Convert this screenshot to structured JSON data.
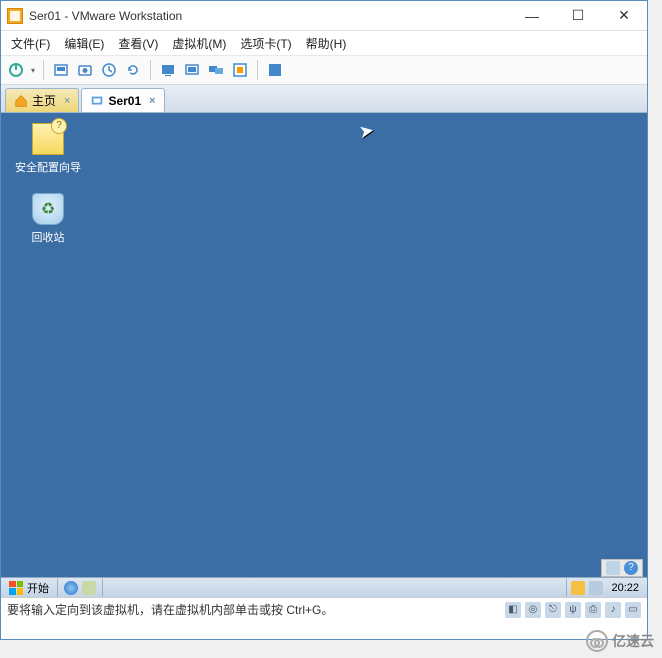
{
  "window": {
    "title": "Ser01 - VMware Workstation"
  },
  "menu": {
    "file": "文件(F)",
    "edit": "编辑(E)",
    "view": "查看(V)",
    "vm": "虚拟机(M)",
    "tabs": "选项卡(T)",
    "help": "帮助(H)"
  },
  "tabs": {
    "home": "主页",
    "vm1": "Ser01"
  },
  "desktop": {
    "security_wizard": "安全配置向导",
    "recycle_bin": "回收站"
  },
  "guest_taskbar": {
    "start": "开始",
    "clock": "20:22"
  },
  "hint": {
    "text": "要将输入定向到该虚拟机，请在虚拟机内部单击或按 Ctrl+G。"
  },
  "watermark": {
    "text": "亿速云"
  },
  "colors": {
    "desktop_bg": "#3a6ea5",
    "accent": "#4a90d9"
  }
}
